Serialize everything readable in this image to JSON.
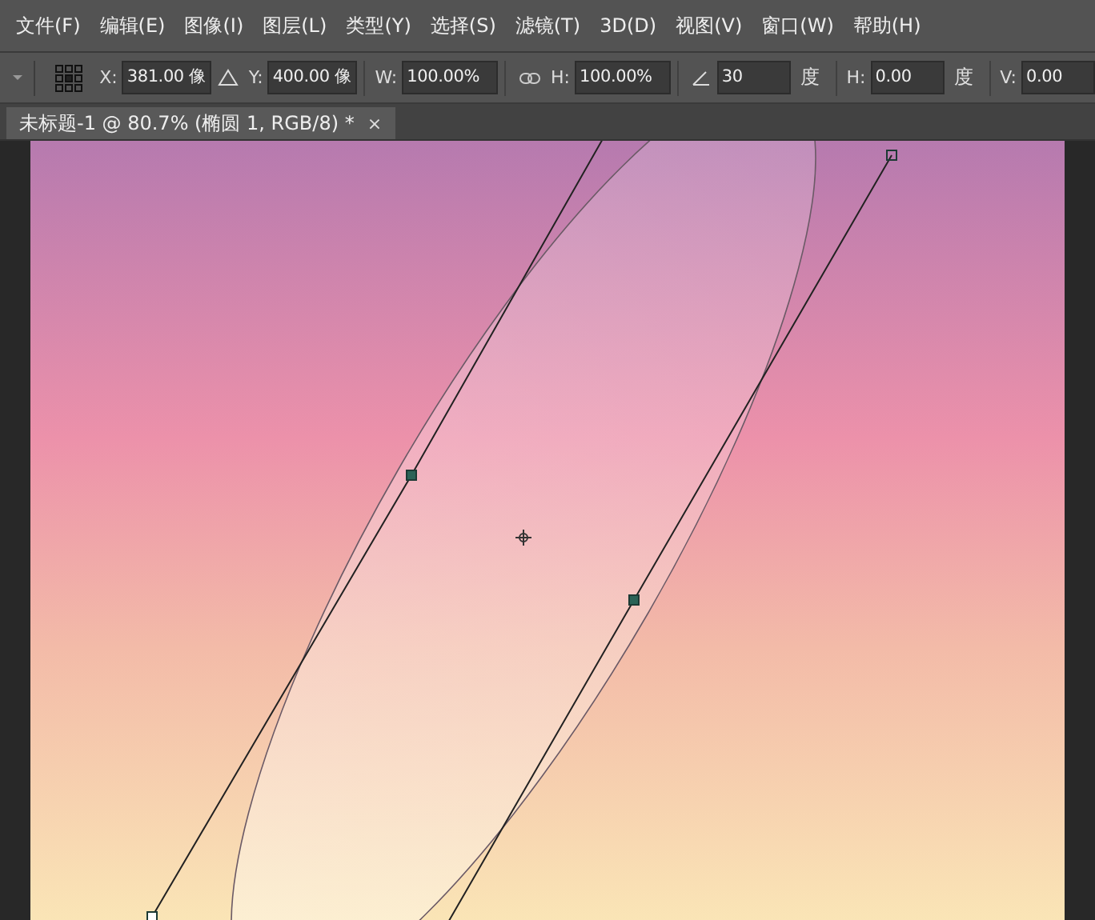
{
  "menu": [
    "文件(F)",
    "编辑(E)",
    "图像(I)",
    "图层(L)",
    "类型(Y)",
    "选择(S)",
    "滤镜(T)",
    "3D(D)",
    "视图(V)",
    "窗口(W)",
    "帮助(H)"
  ],
  "options": [
    {
      "kind": "field",
      "label": "X:",
      "value": "381.00 像"
    },
    {
      "kind": "delta-field",
      "label": "Y:",
      "value": "400.00 像"
    },
    {
      "kind": "field",
      "label": "W:",
      "value": "100.00%"
    },
    {
      "kind": "link-field",
      "label": "H:",
      "value": "100.00%"
    },
    {
      "kind": "angle-field",
      "value": "30",
      "unit": "度"
    },
    {
      "kind": "field",
      "label": "H:",
      "value": "0.00",
      "unit": "度"
    },
    {
      "kind": "field",
      "label": "V:",
      "value": "0.00"
    }
  ],
  "document_tab": {
    "title": "未标题-1 @ 80.7% (椭圆 1, RGB/8) *",
    "close": "×"
  }
}
